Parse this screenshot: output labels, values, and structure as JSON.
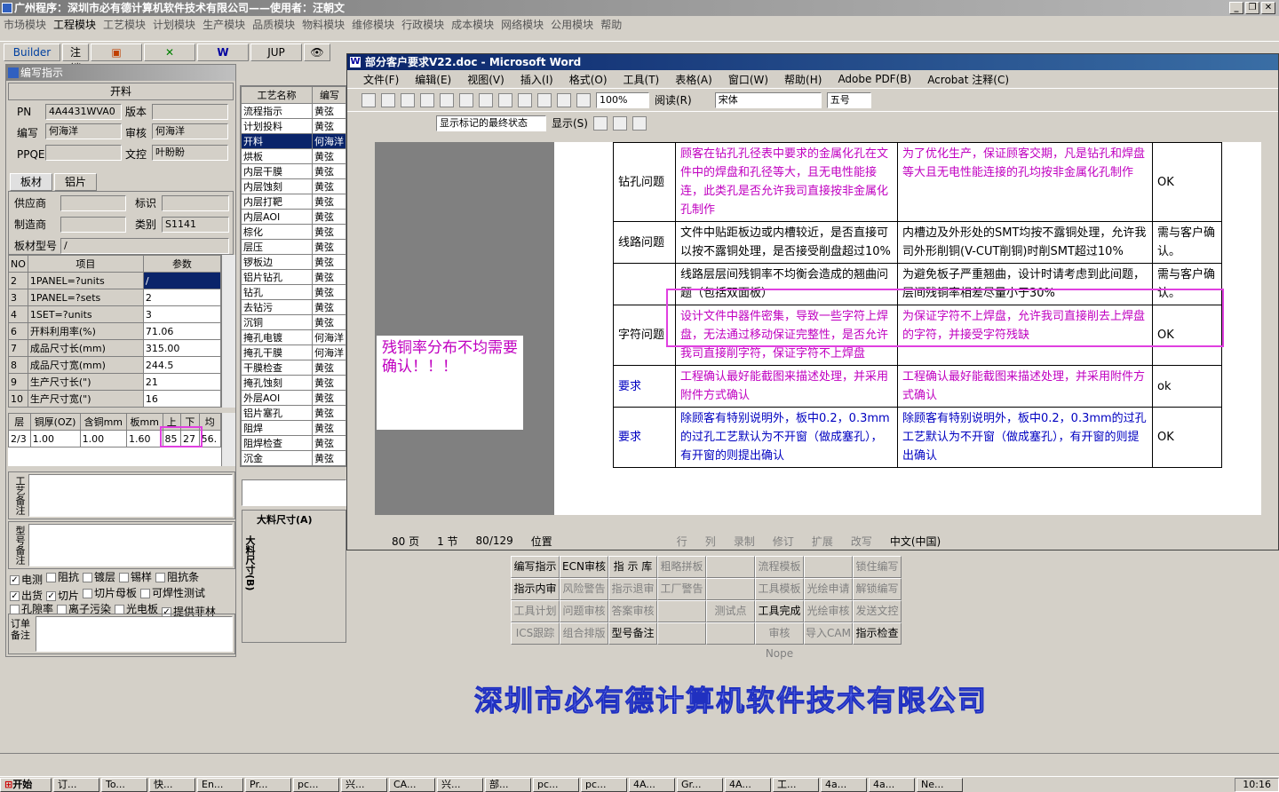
{
  "app": {
    "title": "广州程序：深圳市必有德计算机软件技术有限公司——使用者：汪朝文"
  },
  "menu": [
    "市场模块",
    "工程模块",
    "工艺模块",
    "计划模块",
    "生产模块",
    "品质模块",
    "物料模块",
    "维修模块",
    "行政模块",
    "成本模块",
    "网络模块",
    "公用模块",
    "帮助"
  ],
  "toolbar": {
    "builder": "Builder",
    "logout": "注销",
    "jup": "JUP"
  },
  "panel": {
    "title": "编写指示",
    "open_label": "开料",
    "pn_label": "PN",
    "pn": "4A4431WVA0",
    "version_label": "版本",
    "version": "",
    "author_label": "编写",
    "author": "何海洋",
    "review_label": "审核",
    "reviewer": "何海洋",
    "ppqe_label": "PPQE",
    "ppqe": "",
    "doc_label": "文控",
    "doc": "叶盼盼",
    "tab1": "板材",
    "tab2": "铝片",
    "supplier_label": "供应商",
    "mark_label": "标识",
    "maker_label": "制造商",
    "category_label": "类别",
    "category": "S1141",
    "model_label": "板材型号",
    "model": "/"
  },
  "params": {
    "headers": [
      "NO",
      "项目",
      "参数"
    ],
    "rows": [
      [
        "2",
        "1PANEL=?units",
        "/"
      ],
      [
        "3",
        "1PANEL=?sets",
        "2"
      ],
      [
        "4",
        "1SET=?units",
        "3"
      ],
      [
        "6",
        "开料利用率(%)",
        "71.06"
      ],
      [
        "7",
        "成品尺寸长(mm)",
        "315.00"
      ],
      [
        "8",
        "成品尺寸宽(mm)",
        "244.5"
      ],
      [
        "9",
        "生产尺寸长(\")",
        "21"
      ],
      [
        "10",
        "生产尺寸宽(\")",
        "16"
      ]
    ]
  },
  "layers": {
    "headers": [
      "层",
      "铜厚(OZ)",
      "含铜mm",
      "板mm",
      "上",
      "下",
      "均"
    ],
    "row": [
      "2/3",
      "1.00",
      "1.00",
      "1.60",
      "85",
      "27",
      "56."
    ]
  },
  "notes": {
    "craft": "工艺备注",
    "model": "型号备注",
    "order": "订单备注"
  },
  "checks": [
    [
      "电测",
      true
    ],
    [
      "阻抗",
      false
    ],
    [
      "镀层",
      false
    ],
    [
      "锡样",
      false
    ],
    [
      "阻抗条",
      false
    ],
    [
      "出货",
      true
    ],
    [
      "切片",
      true
    ],
    [
      "切片母板",
      false
    ],
    [
      "可焊性测试",
      false
    ],
    [
      "孔隙率",
      false
    ],
    [
      "离子污染",
      false
    ],
    [
      "光电板",
      false
    ],
    [
      "提供菲林",
      true
    ]
  ],
  "process": {
    "header_name": "工艺名称",
    "header_author": "编写",
    "items": [
      [
        "流程指示",
        "黄弦"
      ],
      [
        "计划投料",
        "黄弦"
      ],
      [
        "开料",
        "何海洋"
      ],
      [
        "烘板",
        "黄弦"
      ],
      [
        "内层干膜",
        "黄弦"
      ],
      [
        "内层蚀刻",
        "黄弦"
      ],
      [
        "内层打靶",
        "黄弦"
      ],
      [
        "内层AOI",
        "黄弦"
      ],
      [
        "棕化",
        "黄弦"
      ],
      [
        "层压",
        "黄弦"
      ],
      [
        "锣板边",
        "黄弦"
      ],
      [
        "铝片钻孔",
        "黄弦"
      ],
      [
        "钻孔",
        "黄弦"
      ],
      [
        "去钻污",
        "黄弦"
      ],
      [
        "沉铜",
        "黄弦"
      ],
      [
        "掩孔电镀",
        "何海洋"
      ],
      [
        "掩孔干膜",
        "何海洋"
      ],
      [
        "干膜检查",
        "黄弦"
      ],
      [
        "掩孔蚀刻",
        "黄弦"
      ],
      [
        "外层AOI",
        "黄弦"
      ],
      [
        "铝片塞孔",
        "黄弦"
      ],
      [
        "阻焊",
        "黄弦"
      ],
      [
        "阻焊检查",
        "黄弦"
      ],
      [
        "沉金",
        "黄弦"
      ]
    ]
  },
  "dims": {
    "big_w": "大料尺寸(A)",
    "big_l": "大料尺寸(B)"
  },
  "buttons": [
    [
      [
        "编写指示",
        true
      ],
      [
        "ECN审核",
        true
      ],
      [
        "指 示 库",
        true
      ],
      [
        "粗略拼板",
        false
      ],
      [
        "",
        false
      ],
      [
        "流程模板",
        false
      ],
      [
        "",
        false
      ],
      [
        "锁住编写",
        false
      ]
    ],
    [
      [
        "指示内审",
        true
      ],
      [
        "风险警告",
        false
      ],
      [
        "指示退审",
        false
      ],
      [
        "工厂警告",
        false
      ],
      [
        "",
        false
      ],
      [
        "工具模板",
        false
      ],
      [
        "光绘申请",
        false
      ],
      [
        "解锁编写",
        false
      ]
    ],
    [
      [
        "工具计划",
        false
      ],
      [
        "问题审核",
        false
      ],
      [
        "答案审核",
        false
      ],
      [
        "",
        false
      ],
      [
        "测试点",
        false
      ],
      [
        "工具完成",
        true
      ],
      [
        "光绘审核",
        false
      ],
      [
        "发送文控",
        false
      ]
    ],
    [
      [
        "ICS跟踪",
        false
      ],
      [
        "组合排版",
        false
      ],
      [
        "型号备注",
        true
      ],
      [
        "",
        false
      ],
      [
        "",
        false
      ],
      [
        "审核Nope",
        false
      ],
      [
        "导入CAM",
        false
      ],
      [
        "指示检查",
        true
      ]
    ]
  ],
  "word": {
    "title": "部分客户要求V22.doc - Microsoft Word",
    "menu": [
      "文件(F)",
      "编辑(E)",
      "视图(V)",
      "插入(I)",
      "格式(O)",
      "工具(T)",
      "表格(A)",
      "窗口(W)",
      "帮助(H)",
      "Adobe PDF(B)",
      "Acrobat 注释(C)"
    ],
    "zoom": "100%",
    "read": "阅读(R)",
    "font": "宋体",
    "size": "五号",
    "markup": "显示标记的最终状态",
    "show": "显示(S)",
    "note": "残铜率分布不均需要确认！！！",
    "rows": [
      {
        "cat": "钻孔问题",
        "q": "顾客在钻孔孔径表中要求的金属化孔在文件中的焊盘和孔径等大，且无电性能接连，此类孔是否允许我司直接按非金属化孔制作",
        "a": "为了优化生产，保证顾客交期，凡是钻孔和焊盘等大且无电性能连接的孔均按非金属化孔制作",
        "r": "OK",
        "qc": "mag",
        "ac": "mag"
      },
      {
        "cat": "线路问题",
        "q": "文件中贴距板边或内槽较近，是否直接可以按不露铜处理，是否接受削盘超过10%",
        "a": "内槽边及外形处的SMT均按不露铜处理，允许我司外形削铜(V-CUT削铜)时削SMT超过10%",
        "r": "需与客户确认。",
        "qc": "",
        "ac": ""
      },
      {
        "cat": "",
        "q": "线路层层间残铜率不均衡会造成的翘曲问题（包括双面板）",
        "a": "为避免板子严重翘曲，设计时请考虑到此间题，层间残铜率相差尽量小于30%",
        "r": "需与客户确认。",
        "qc": "",
        "ac": ""
      },
      {
        "cat": "字符问题",
        "q": "设计文件中器件密集，导致一些字符上焊盘，无法通过移动保证完整性，是否允许我司直接削字符，保证字符不上焊盘",
        "a": "为保证字符不上焊盘，允许我司直接削去上焊盘的字符，并接受字符残缺",
        "r": "OK",
        "qc": "mag",
        "ac": "mag"
      },
      {
        "cat": "要求",
        "q": "工程确认最好能截图来描述处理，并采用附件方式确认",
        "a": "工程确认最好能截图来描述处理，并采用附件方式确认",
        "r": "ok",
        "qc": "mag",
        "ac": "mag"
      },
      {
        "cat": "要求",
        "q": "除顾客有特别说明外，板中0.2，0.3mm的过孔工艺默认为不开窗（做成塞孔），有开窗的则提出确认",
        "a": "除顾客有特别说明外，板中0.2，0.3mm的过孔工艺默认为不开窗（做成塞孔），有开窗的则提出确认",
        "r": "OK",
        "qc": "blue",
        "ac": "blue"
      }
    ],
    "status": {
      "page": "80 页",
      "section": "1 节",
      "pos": "80/129",
      "at": "位置",
      "row": "行",
      "col": "列",
      "rec": "录制",
      "rev": "修订",
      "ext": "扩展",
      "ovr": "改写",
      "lang": "中文(中国)"
    }
  },
  "company": "深圳市必有德计算机软件技术有限公司",
  "taskbar": {
    "start": "开始",
    "tasks": [
      "订...",
      "To...",
      "快...",
      "En...",
      "Pr...",
      "pc...",
      "兴...",
      "CA...",
      "兴...",
      "部...",
      "pc...",
      "pc...",
      "4A...",
      "Gr...",
      "4A...",
      "工...",
      "4a...",
      "4a...",
      "Ne..."
    ],
    "clock": "10:16"
  }
}
